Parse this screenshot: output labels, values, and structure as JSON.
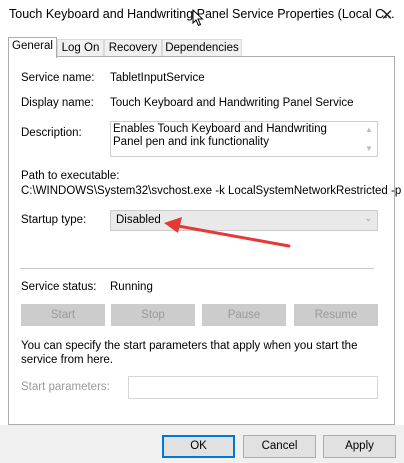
{
  "window": {
    "title": "Touch Keyboard and Handwriting Panel Service Properties (Local C...",
    "close_glyph": "✕"
  },
  "tabs": [
    {
      "label": "General",
      "active": true
    },
    {
      "label": "Log On",
      "active": false
    },
    {
      "label": "Recovery",
      "active": false
    },
    {
      "label": "Dependencies",
      "active": false
    }
  ],
  "general": {
    "service_name_label": "Service name:",
    "service_name": "TabletInputService",
    "display_name_label": "Display name:",
    "display_name": "Touch Keyboard and Handwriting Panel Service",
    "description_label": "Description:",
    "description": "Enables Touch Keyboard and Handwriting Panel pen and ink functionality",
    "path_label": "Path to executable:",
    "path": "C:\\WINDOWS\\System32\\svchost.exe -k LocalSystemNetworkRestricted -p",
    "startup_type_label": "Startup type:",
    "startup_type": "Disabled",
    "service_status_label": "Service status:",
    "service_status": "Running",
    "buttons": {
      "start": "Start",
      "stop": "Stop",
      "pause": "Pause",
      "resume": "Resume"
    },
    "info_text": "You can specify the start parameters that apply when you start the service from here.",
    "start_params_label": "Start parameters:",
    "start_params_value": ""
  },
  "footer": {
    "ok": "OK",
    "cancel": "Cancel",
    "apply": "Apply"
  },
  "colors": {
    "annotation_arrow": "#e53935",
    "default_button_border": "#0078d7"
  }
}
